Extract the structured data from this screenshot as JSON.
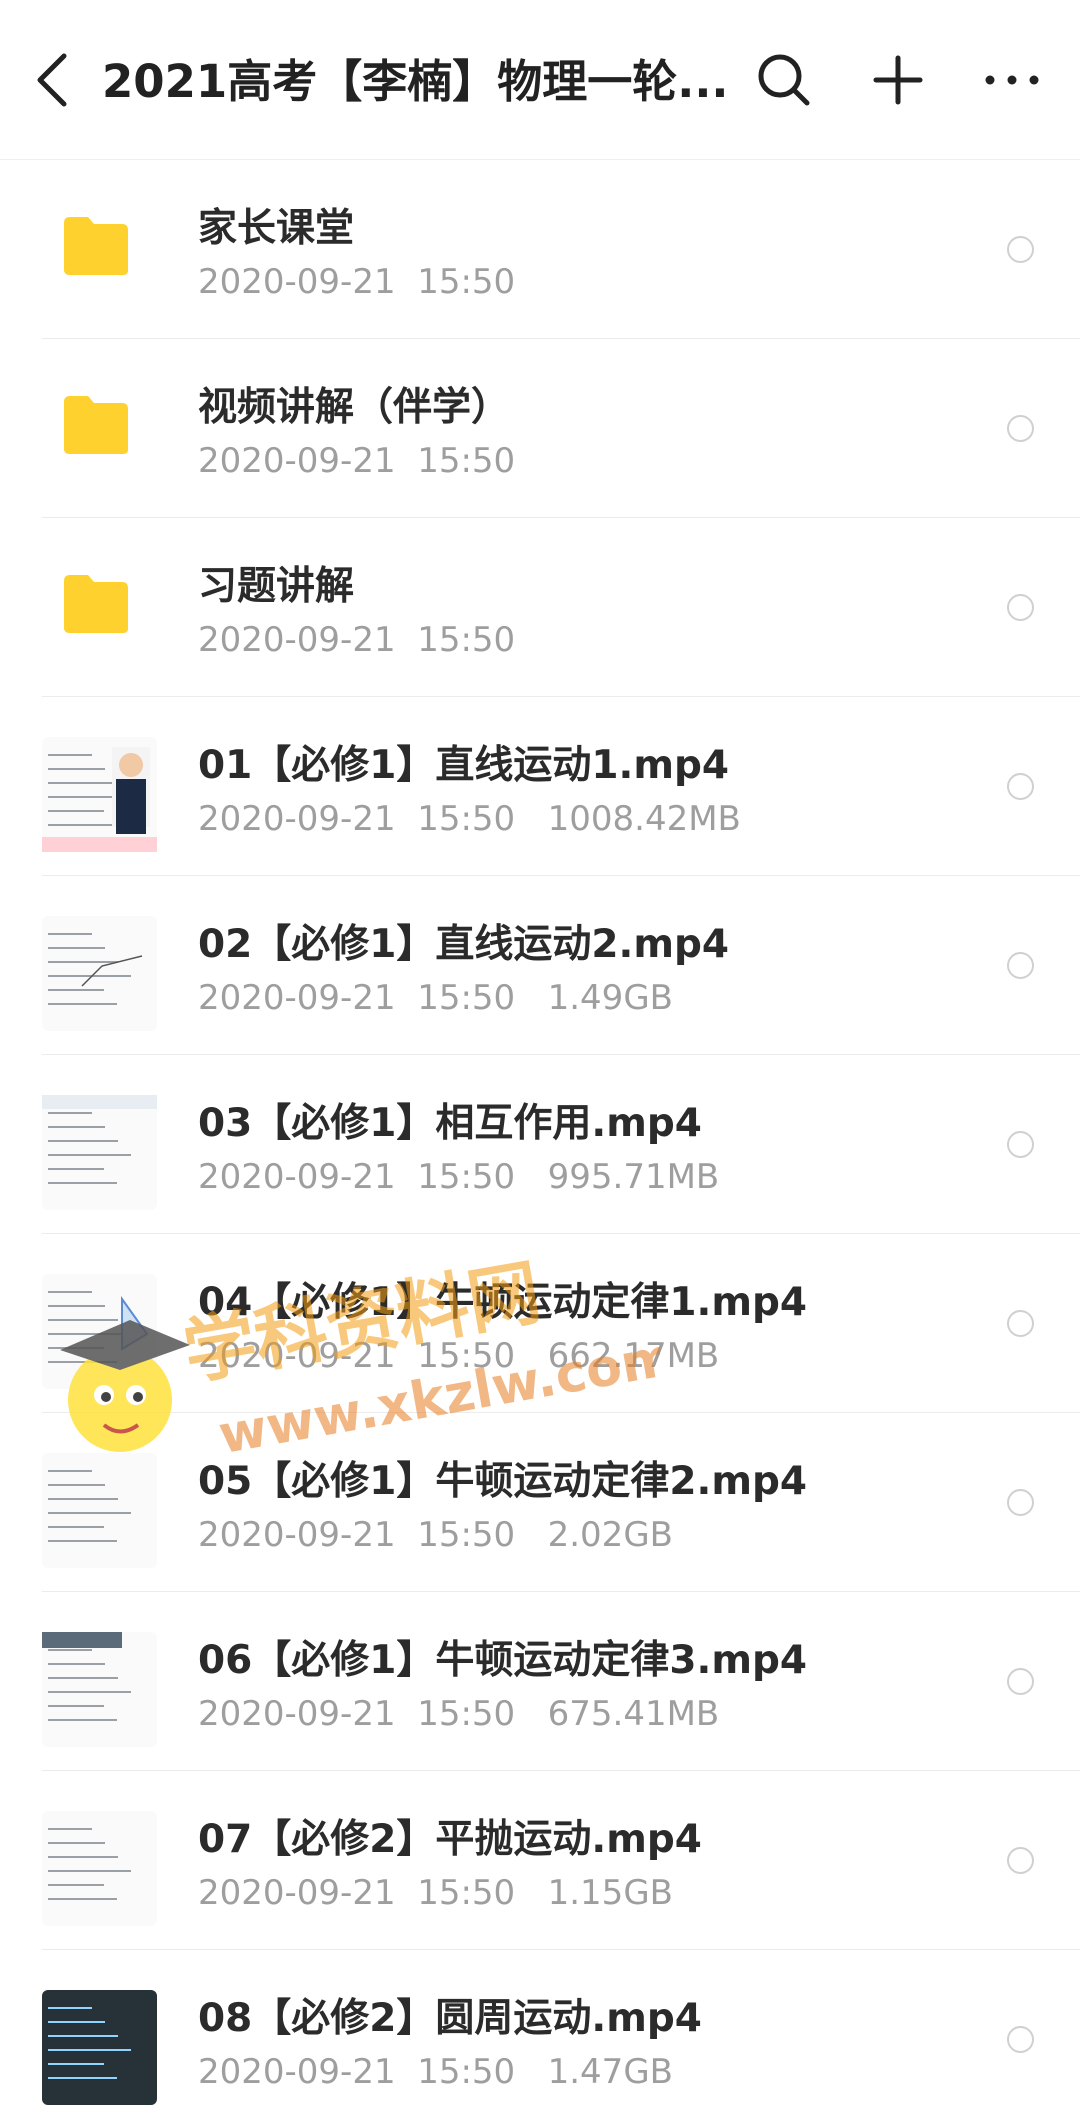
{
  "header": {
    "title": "2021高考【李楠】物理一轮...",
    "back_icon": "chevron-left-icon",
    "search_icon": "search-icon",
    "add_icon": "plus-icon",
    "more_icon": "more-horizontal-icon"
  },
  "colors": {
    "folder": "#FFD12E",
    "text_primary": "#2b2b2b",
    "text_secondary": "#9e9e9e"
  },
  "items": [
    {
      "name": "家长课堂",
      "meta": "2020-09-21  15:50",
      "type": "folder"
    },
    {
      "name": "视频讲解（伴学）",
      "meta": "2020-09-21  15:50",
      "type": "folder"
    },
    {
      "name": "习题讲解",
      "meta": "2020-09-21  15:50",
      "type": "folder"
    },
    {
      "name": "01【必修1】直线运动1.mp4",
      "meta": "2020-09-21  15:50   1008.42MB",
      "type": "video"
    },
    {
      "name": "02【必修1】直线运动2.mp4",
      "meta": "2020-09-21  15:50   1.49GB",
      "type": "video"
    },
    {
      "name": "03【必修1】相互作用.mp4",
      "meta": "2020-09-21  15:50   995.71MB",
      "type": "video"
    },
    {
      "name": "04【必修1】牛顿运动定律1.mp4",
      "meta": "2020-09-21  15:50   662.17MB",
      "type": "video"
    },
    {
      "name": "05【必修1】牛顿运动定律2.mp4",
      "meta": "2020-09-21  15:50   2.02GB",
      "type": "video"
    },
    {
      "name": "06【必修1】牛顿运动定律3.mp4",
      "meta": "2020-09-21  15:50   675.41MB",
      "type": "video"
    },
    {
      "name": "07【必修2】平抛运动.mp4",
      "meta": "2020-09-21  15:50   1.15GB",
      "type": "video"
    },
    {
      "name": "08【必修2】圆周运动.mp4",
      "meta": "2020-09-21  15:50   1.47GB",
      "type": "video"
    }
  ],
  "watermark": {
    "text_top": "学科资料网",
    "text_url": "www.xkzlw.com"
  }
}
